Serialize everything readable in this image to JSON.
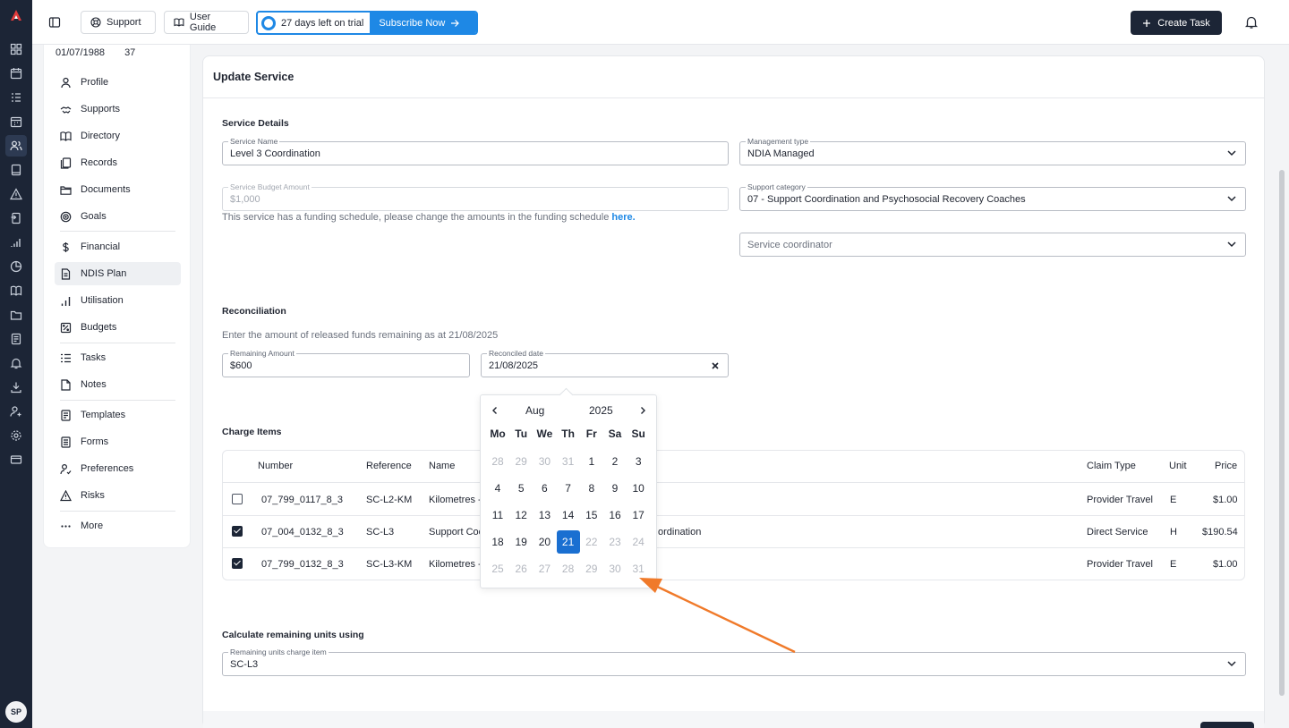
{
  "topbar": {
    "support": "Support",
    "user_guide": "User Guide",
    "trial_text": "27 days left on trial",
    "subscribe": "Subscribe Now",
    "create_task": "Create Task"
  },
  "rail": {
    "avatar": "SP"
  },
  "client": {
    "dob": "01/07/1988",
    "age": "37"
  },
  "nav": {
    "profile": "Profile",
    "supports": "Supports",
    "directory": "Directory",
    "records": "Records",
    "documents": "Documents",
    "goals": "Goals",
    "financial": "Financial",
    "ndis_plan": "NDIS Plan",
    "utilisation": "Utilisation",
    "budgets": "Budgets",
    "tasks": "Tasks",
    "notes": "Notes",
    "templates": "Templates",
    "forms": "Forms",
    "preferences": "Preferences",
    "risks": "Risks",
    "more": "More"
  },
  "form": {
    "title": "Update Service",
    "service_details": "Service Details",
    "service_name_label": "Service Name",
    "service_name": "Level 3 Coordination",
    "management_type_label": "Management type",
    "management_type": "NDIA Managed",
    "budget_label": "Service Budget Amount",
    "budget": "$1,000",
    "support_category_label": "Support category",
    "support_category": "07 - Support Coordination and Psychosocial Recovery Coaches",
    "funding_note": "This service has a funding schedule, please change the amounts in the funding schedule",
    "funding_link": "here.",
    "service_coordinator": "Service coordinator",
    "reconciliation": "Reconciliation",
    "reconciliation_note": "Enter the amount of released funds remaining as at 21/08/2025",
    "remaining_label": "Remaining Amount",
    "remaining": "$600",
    "reconciled_label": "Reconciled date",
    "reconciled": "21/08/2025",
    "charge_items": "Charge Items",
    "calc_heading": "Calculate remaining units using",
    "remaining_units_label": "Remaining units charge item",
    "remaining_units": "SC-L3"
  },
  "table": {
    "headers": {
      "number": "Number",
      "reference": "Reference",
      "name": "Name",
      "claim_type": "Claim Type",
      "unit": "Unit",
      "price": "Price"
    },
    "rows": [
      {
        "number": "07_799_0117_8_3",
        "reference": "SC-L2-KM",
        "name_left": "Kilometres -",
        "name_right": "",
        "claim_type": "Provider Travel",
        "unit": "E",
        "price": "$1.00",
        "checked": false
      },
      {
        "number": "07_004_0132_8_3",
        "reference": "SC-L3",
        "name_left": "Support Coo",
        "name_right": "ordination",
        "claim_type": "Direct Service",
        "unit": "H",
        "price": "$190.54",
        "checked": true
      },
      {
        "number": "07_799_0132_8_3",
        "reference": "SC-L3-KM",
        "name_left": "Kilometres -",
        "name_right": "",
        "claim_type": "Provider Travel",
        "unit": "E",
        "price": "$1.00",
        "checked": true
      }
    ]
  },
  "datepicker": {
    "month": "Aug",
    "year": "2025",
    "weekdays": [
      "Mo",
      "Tu",
      "We",
      "Th",
      "Fr",
      "Sa",
      "Su"
    ],
    "weeks": [
      [
        "28",
        "29",
        "30",
        "31",
        "1",
        "2",
        "3"
      ],
      [
        "4",
        "5",
        "6",
        "7",
        "8",
        "9",
        "10"
      ],
      [
        "11",
        "12",
        "13",
        "14",
        "15",
        "16",
        "17"
      ],
      [
        "18",
        "19",
        "20",
        "21",
        "22",
        "23",
        "24"
      ],
      [
        "25",
        "26",
        "27",
        "28",
        "29",
        "30",
        "31"
      ]
    ],
    "selected": "21"
  },
  "colors": {
    "brand_dark": "#1c2536",
    "accent": "#1e88e5",
    "selected_day": "#1a6fd1",
    "annotation_arrow": "#f07a2a"
  }
}
